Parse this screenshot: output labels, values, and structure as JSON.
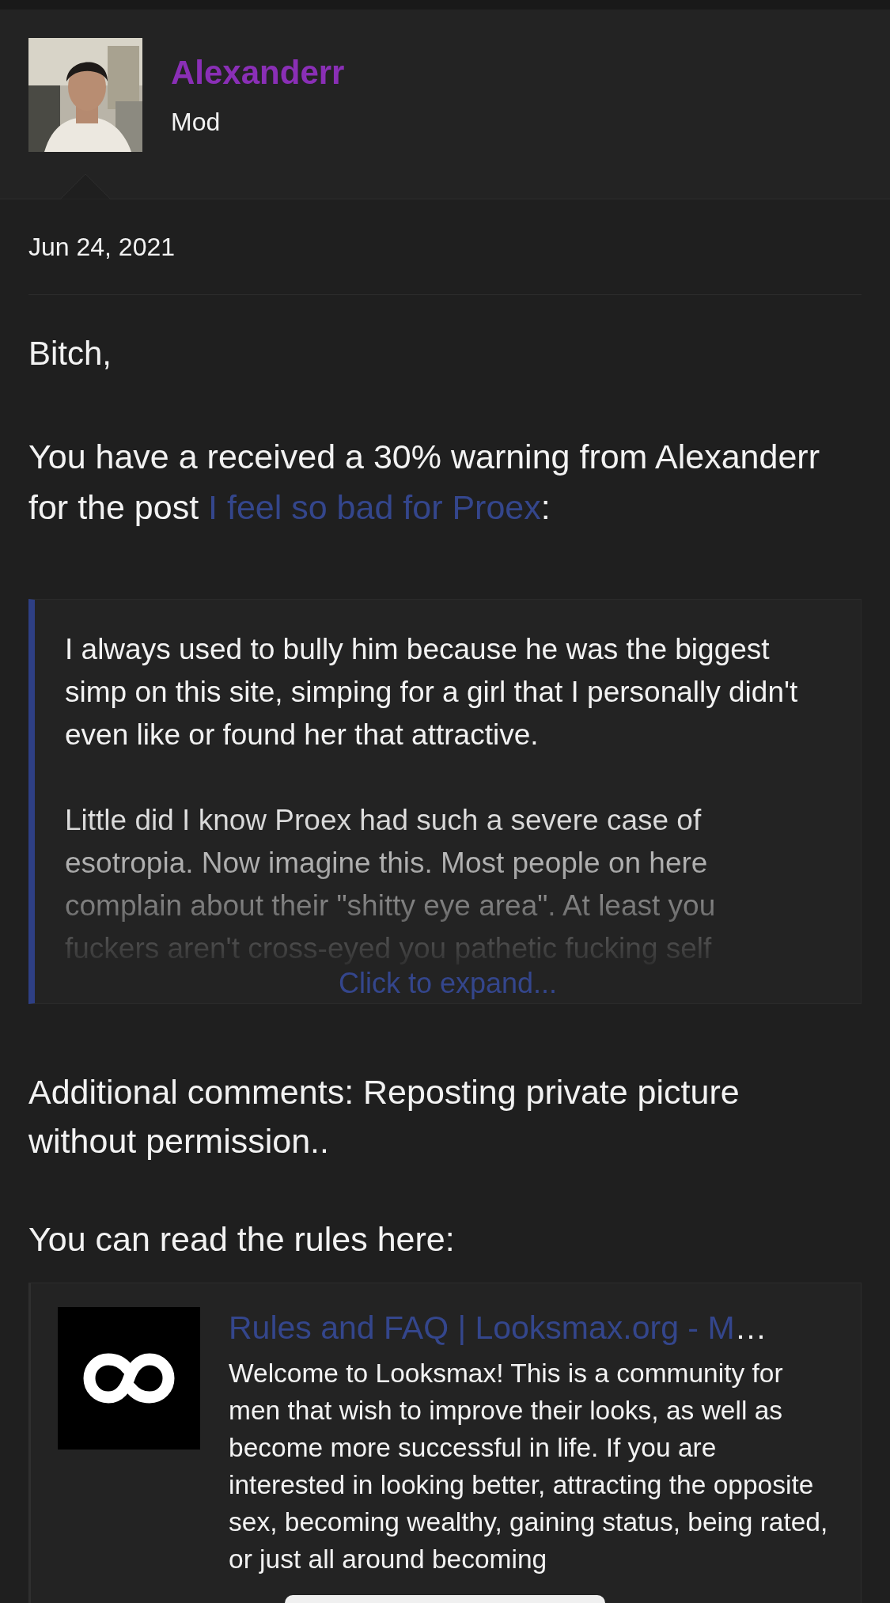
{
  "author": {
    "name": "Alexanderr",
    "role": "Mod"
  },
  "date": "Jun 24, 2021",
  "greeting": "Bitch,",
  "warning": {
    "before": "You have a received a 30% warning from Alexanderr for the post ",
    "link": "I feel so bad for Proex",
    "after": ":"
  },
  "quote": {
    "paragraphs": [
      "I always used to bully him because he was the biggest simp on this site, simping for a girl that I personally didn't even like or found her that attractive.",
      "Little did I know Proex had such a severe case of esotropia. Now imagine this. Most people on here complain about their \"shitty eye area\". At least you fuckers aren't cross-eyed you pathetic fucking self"
    ],
    "expand": "Click to expand..."
  },
  "comments": "Additional comments: Reposting private picture without permission..",
  "rules_intro": "You can read the rules here:",
  "link_card": {
    "title": "Rules and FAQ | Looksmax.org - M…",
    "description": "Welcome to Looksmax! This is a community for men that wish to improve their looks, as well as become more successful in life. If you are interested in looking better, attracting the opposite sex, becoming wealthy, gaining status, being rated, or just all around becoming"
  }
}
